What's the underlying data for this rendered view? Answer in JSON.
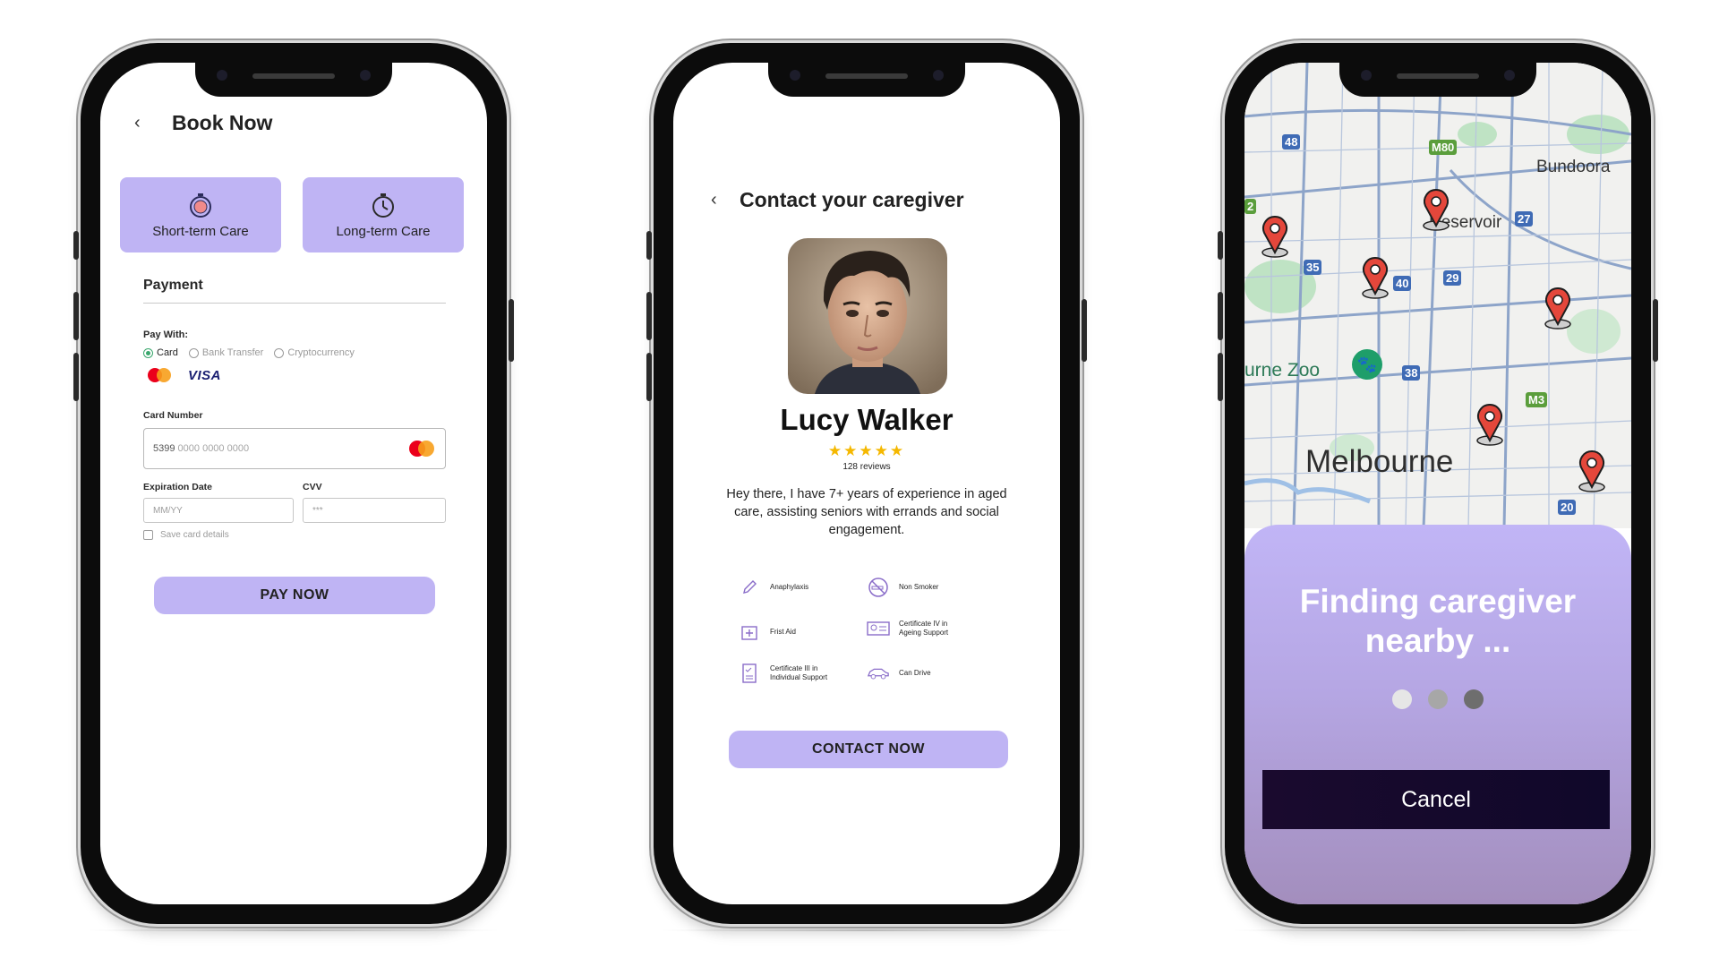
{
  "book": {
    "back_icon": "chevron-left-icon",
    "title": "Book Now",
    "options": [
      {
        "label": "Short-term Care",
        "icon": "stopwatch-icon"
      },
      {
        "label": "Long-term Care",
        "icon": "timer-icon"
      }
    ],
    "payment_title": "Payment",
    "pay_with_label": "Pay With:",
    "methods": [
      "Card",
      "Bank Transfer",
      "Cryptocurrency"
    ],
    "selected_method": "Card",
    "brands": [
      "mastercard",
      "VISA"
    ],
    "card_number_label": "Card Number",
    "card_number_prefix": "5399",
    "card_number_rest": "0000 0000 0000",
    "expiration_label": "Expiration Date",
    "expiration_placeholder": "MM/YY",
    "cvv_label": "CVV",
    "cvv_placeholder": "***",
    "save_card_label": "Save card details",
    "pay_button": "PAY NOW"
  },
  "contact": {
    "title": "Contact your caregiver",
    "name": "Lucy Walker",
    "stars": "★★★★★",
    "rating": 5,
    "reviews": "128 reviews",
    "bio": "Hey there, I have 7+ years of experience in aged care, assisting seniors with errands and social engagement.",
    "attributes": [
      {
        "label": "Anaphylaxis",
        "icon": "pen-icon"
      },
      {
        "label": "Non Smoker",
        "icon": "no-smoking-icon"
      },
      {
        "label": "Frist Aid",
        "icon": "first-aid-icon"
      },
      {
        "label": "Certificate IV in Ageing Support",
        "icon": "id-card-icon"
      },
      {
        "label": "Certificate III in Individual Support",
        "icon": "checklist-icon"
      },
      {
        "label": "Can Drive",
        "icon": "car-icon"
      }
    ],
    "contact_button": "CONTACT NOW"
  },
  "finding": {
    "map_labels": {
      "bundoora": "Bundoora",
      "reservoir": "Reservoir",
      "zoo": "urne Zoo",
      "melbourne": "Melbourne"
    },
    "road_badges": [
      "48",
      "M80",
      "27",
      "35",
      "40",
      "29",
      "38",
      "M3",
      "20",
      "2"
    ],
    "message": "Finding caregiver nearby ...",
    "cancel_button": "Cancel",
    "dot_colors": [
      "#e6e6e6",
      "#a7a7a7",
      "#6e6e6e"
    ]
  },
  "colors": {
    "accent": "#bfb4f4",
    "cancel_bg": "#150a2b",
    "pin": "#e4473b"
  }
}
